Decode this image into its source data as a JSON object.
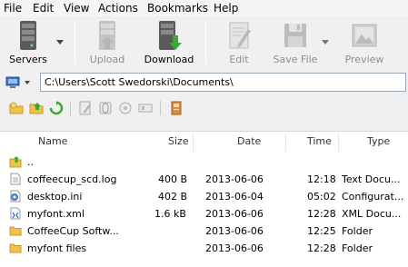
{
  "menu": [
    "File",
    "Edit",
    "View",
    "Actions",
    "Bookmarks",
    "Help"
  ],
  "toolbar": {
    "servers": "Servers",
    "upload": "Upload",
    "download": "Download",
    "edit": "Edit",
    "save_file": "Save File",
    "preview": "Preview"
  },
  "path": {
    "value": "C:\\Users\\Scott Swedorski\\Documents\\"
  },
  "columns": {
    "name": "Name",
    "size": "Size",
    "date": "Date",
    "time": "Time",
    "type": "Type"
  },
  "files": [
    {
      "name": "..",
      "size": "",
      "date": "",
      "time": "",
      "type": "",
      "icon": "parent-folder-icon"
    },
    {
      "name": "coffeecup_scd.log",
      "size": "400 B",
      "date": "2013-06-06",
      "time": "12:18",
      "type": "Text Docu...",
      "icon": "text-file-icon"
    },
    {
      "name": "desktop.ini",
      "size": "402 B",
      "date": "2013-06-04",
      "time": "05:02",
      "type": "Configurat...",
      "icon": "config-file-icon"
    },
    {
      "name": "myfont.xml",
      "size": "1.6 kB",
      "date": "2013-06-06",
      "time": "12:28",
      "type": "XML Docu...",
      "icon": "xml-file-icon"
    },
    {
      "name": "CoffeeCup Softw...",
      "size": "",
      "date": "2013-06-06",
      "time": "12:25",
      "type": "Folder",
      "icon": "folder-icon"
    },
    {
      "name": "myfont files",
      "size": "",
      "date": "2013-06-06",
      "time": "12:28",
      "type": "Folder",
      "icon": "folder-icon"
    }
  ]
}
